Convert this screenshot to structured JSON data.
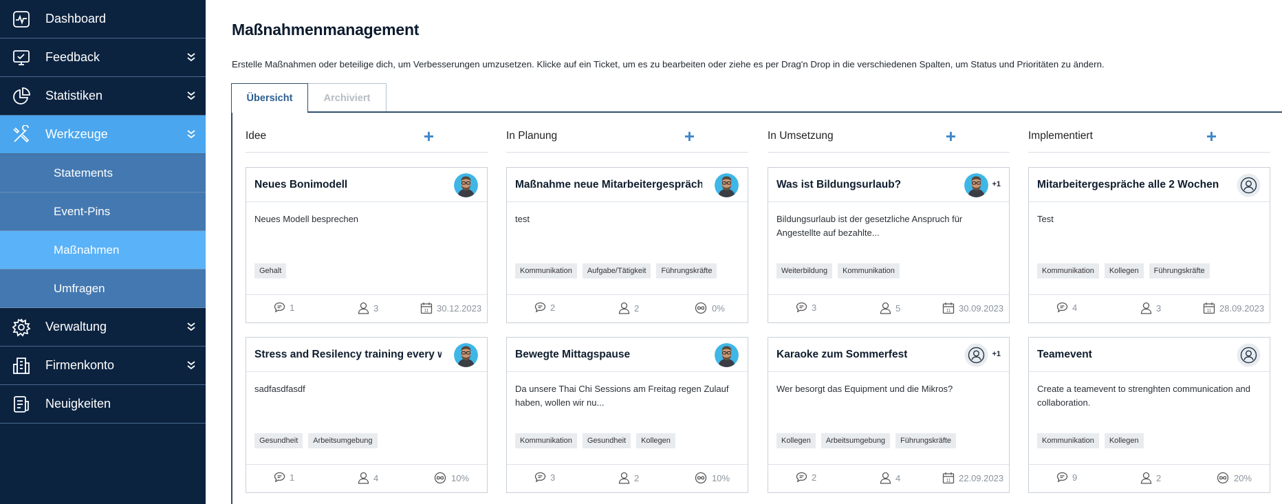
{
  "sidebar": {
    "items": [
      {
        "label": "Dashboard",
        "icon": "dashboard-icon"
      },
      {
        "label": "Feedback",
        "icon": "feedback-icon"
      },
      {
        "label": "Statistiken",
        "icon": "statistics-icon"
      },
      {
        "label": "Werkzeuge",
        "icon": "tools-icon"
      },
      {
        "label": "Verwaltung",
        "icon": "gear-icon"
      },
      {
        "label": "Firmenkonto",
        "icon": "building-icon"
      },
      {
        "label": "Neuigkeiten",
        "icon": "news-icon"
      }
    ],
    "subitems": [
      "Statements",
      "Event-Pins",
      "Maßnahmen",
      "Umfragen"
    ]
  },
  "header": {
    "title": "Maßnahmenmanagement",
    "description": "Erstelle Maßnahmen oder beteilige dich, um Verbesserungen umzusetzen. Klicke auf ein Ticket, um es zu bearbeiten oder ziehe es per Drag'n Drop in die verschiedenen Spalten, um Status und Prioritäten zu ändern."
  },
  "tabs": {
    "overview": "Übersicht",
    "archived": "Archiviert"
  },
  "columns": [
    {
      "title": "Idee",
      "add": "+",
      "cards": [
        {
          "title": "Neues Bonimodell",
          "description": "Neues Modell besprechen",
          "tags": [
            "Gehalt"
          ],
          "comments": "1",
          "members": "3",
          "meta": "30.12.2023",
          "assignee": "photo",
          "extra": ""
        },
        {
          "title": "Stress and Resilency training every wedn",
          "description": "sadfasdfasdf",
          "tags": [
            "Gesundheit",
            "Arbeitsumgebung"
          ],
          "comments": "1",
          "members": "4",
          "meta": "10%",
          "assignee": "photo",
          "extra": ""
        }
      ]
    },
    {
      "title": "In Planung",
      "add": "+",
      "cards": [
        {
          "title": "Maßnahme neue Mitarbeitergespräche",
          "description": "test",
          "tags": [
            "Kommunikation",
            "Aufgabe/Tätigkeit",
            "Führungskräfte"
          ],
          "comments": "2",
          "members": "2",
          "meta": "0%",
          "assignee": "photo",
          "extra": ""
        },
        {
          "title": "Bewegte Mittagspause",
          "description": "Da unsere Thai Chi Sessions am Freitag regen Zulauf haben, wollen wir nu...",
          "tags": [
            "Kommunikation",
            "Gesundheit",
            "Kollegen"
          ],
          "comments": "3",
          "members": "2",
          "meta": "10%",
          "assignee": "photo",
          "extra": ""
        }
      ]
    },
    {
      "title": "In Umsetzung",
      "add": "+",
      "cards": [
        {
          "title": "Was ist Bildungsurlaub?",
          "description": "Bildungsurlaub ist der gesetzliche Anspruch für Angestellte auf bezahlte...",
          "tags": [
            "Weiterbildung",
            "Kommunikation"
          ],
          "comments": "3",
          "members": "5",
          "meta": "30.09.2023",
          "assignee": "photo",
          "extra": "+1"
        },
        {
          "title": "Karaoke zum Sommerfest",
          "description": "Wer besorgt das Equipment und die Mikros?",
          "tags": [
            "Kollegen",
            "Arbeitsumgebung",
            "Führungskräfte"
          ],
          "comments": "2",
          "members": "4",
          "meta": "22.09.2023",
          "assignee": "placeholder",
          "extra": "+1"
        }
      ]
    },
    {
      "title": "Implementiert",
      "add": "+",
      "cards": [
        {
          "title": "Mitarbeitergespräche alle 2 Wochen",
          "description": "Test",
          "tags": [
            "Kommunikation",
            "Kollegen",
            "Führungskräfte"
          ],
          "comments": "4",
          "members": "3",
          "meta": "28.09.2023",
          "assignee": "placeholder",
          "extra": ""
        },
        {
          "title": "Teamevent",
          "description": "Create a teamevent to strenghten communication and collaboration.",
          "tags": [
            "Kommunikation",
            "Kollegen"
          ],
          "comments": "9",
          "members": "2",
          "meta": "20%",
          "assignee": "placeholder",
          "extra": ""
        }
      ]
    }
  ],
  "colors": {
    "sidebar": "#0c2340",
    "active": "#4aa6ee",
    "sub": "#4478b0",
    "accent": "#3f86c8"
  }
}
